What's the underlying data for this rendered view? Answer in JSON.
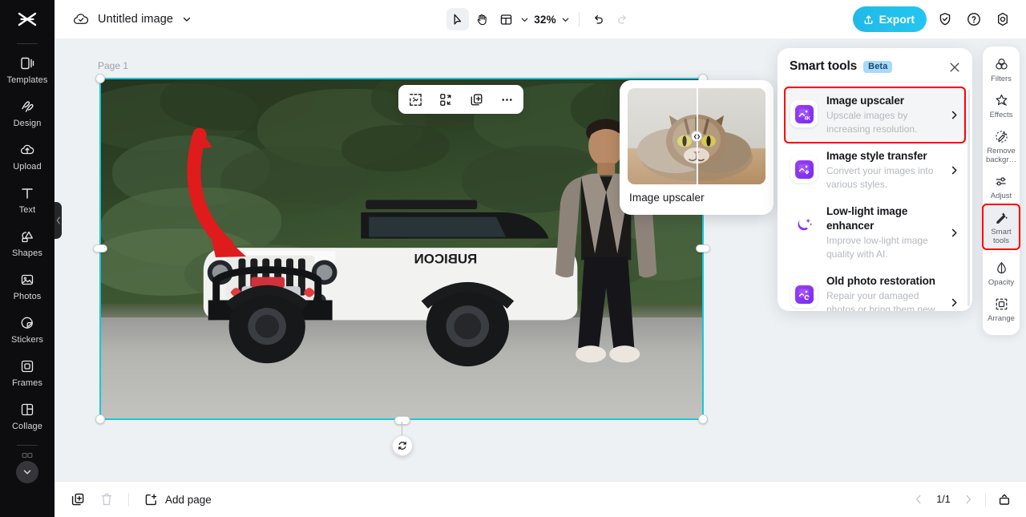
{
  "app": {
    "name": "CapCut",
    "logo_icon": "capcut-logo-icon"
  },
  "topbar": {
    "cloud_icon": "cloud-saved-icon",
    "doc_title": "Untitled image",
    "doc_title_chevron": "chevron-down-icon",
    "tools": [
      {
        "name": "select-tool",
        "icon": "cursor-arrow-icon",
        "active": true
      },
      {
        "name": "hand-tool",
        "icon": "hand-icon",
        "active": false
      },
      {
        "name": "layout-tool",
        "icon": "layout-grid-icon",
        "active": false
      }
    ],
    "layout_chevron": "chevron-down-icon",
    "zoom_level": "32%",
    "zoom_chevron": "chevron-down-icon",
    "undo_icon": "undo-arrow-icon",
    "redo_icon": "redo-arrow-icon",
    "export_label": "Export",
    "export_icon": "upload-icon",
    "export_color": "#22c0ec",
    "right_icons": [
      {
        "name": "shield-check-icon",
        "label": "Security"
      },
      {
        "name": "help-question-icon",
        "label": "Help"
      },
      {
        "name": "settings-gear-icon",
        "label": "Settings"
      }
    ]
  },
  "sidebar": {
    "items": [
      {
        "label": "Templates",
        "icon": "templates-icon"
      },
      {
        "label": "Design",
        "icon": "design-icon"
      },
      {
        "label": "Upload",
        "icon": "upload-cloud-icon"
      },
      {
        "label": "Text",
        "icon": "text-t-icon"
      },
      {
        "label": "Shapes",
        "icon": "shapes-icon"
      },
      {
        "label": "Photos",
        "icon": "photos-image-icon"
      },
      {
        "label": "Stickers",
        "icon": "stickers-icon"
      },
      {
        "label": "Frames",
        "icon": "frames-icon"
      },
      {
        "label": "Collage",
        "icon": "collage-icon"
      }
    ],
    "expand_icon": "chevron-down-circle-icon",
    "collapse_handle_icon": "chevron-left-icon"
  },
  "canvas": {
    "page_label": "Page 1",
    "selection_color": "#19c7de",
    "floating_tools": [
      {
        "name": "crop-tool",
        "icon": "crop-dashed-icon"
      },
      {
        "name": "flip-tool",
        "icon": "flip-swap-icon"
      },
      {
        "name": "duplicate-tool",
        "icon": "duplicate-plus-icon"
      },
      {
        "name": "more-tool",
        "icon": "more-dots-icon"
      }
    ],
    "corner_tools": [
      {
        "name": "replace-image",
        "icon": "image-stack-icon"
      },
      {
        "name": "more-options",
        "icon": "more-dots-icon"
      }
    ],
    "rotate_icon": "rotate-refresh-icon",
    "artwork_alt": "White Jeep Wrangler Rubicon on a forest gravel road with a man in a grey blazer standing beside it, red arrow annotation pointing at the Jeep front grille"
  },
  "preview_card": {
    "label": "Image upscaler",
    "image_alt": "Tabby cat before/after upscaling comparison",
    "split_handle_icon": "split-compare-icon"
  },
  "smart_tools_panel": {
    "title": "Smart tools",
    "badge": "Beta",
    "badge_color": "#aad9fb",
    "close_icon": "close-x-icon",
    "highlight_color": "#ff0000",
    "items": [
      {
        "name": "Image upscaler",
        "description": "Upscale images by increasing resolution.",
        "icon": "image-upscaler-4k-icon",
        "chevron": "chevron-right-icon",
        "selected": true,
        "highlighted": true
      },
      {
        "name": "Image style transfer",
        "description": "Convert your images into various styles.",
        "icon": "image-style-transfer-icon",
        "chevron": "chevron-right-icon",
        "selected": false,
        "highlighted": false
      },
      {
        "name": "Low-light image enhancer",
        "description": "Improve low-light image quality with AI.",
        "icon": "moon-sparkle-icon",
        "chevron": "chevron-right-icon",
        "selected": false,
        "highlighted": false
      },
      {
        "name": "Old photo restoration",
        "description": "Repair your damaged photos or bring them new life with…",
        "icon": "old-photo-restoration-icon",
        "chevron": "chevron-right-icon",
        "selected": false,
        "highlighted": false
      }
    ]
  },
  "right_toolbar": {
    "items": [
      {
        "label": "Filters",
        "icon": "filters-circles-icon",
        "selected": false,
        "highlighted": false
      },
      {
        "label": "Effects",
        "icon": "effects-star-icon",
        "selected": false,
        "highlighted": false
      },
      {
        "label": "Remove backgr…",
        "icon": "remove-background-icon",
        "selected": false,
        "highlighted": false
      },
      {
        "label": "Adjust",
        "icon": "adjust-sliders-icon",
        "selected": false,
        "highlighted": false
      },
      {
        "label": "Smart tools",
        "icon": "smart-tools-wand-icon",
        "selected": true,
        "highlighted": true
      },
      {
        "label": "Opacity",
        "icon": "opacity-drop-icon",
        "selected": false,
        "highlighted": false
      },
      {
        "label": "Arrange",
        "icon": "arrange-dashed-icon",
        "selected": false,
        "highlighted": false
      }
    ]
  },
  "bottombar": {
    "duplicate_page_icon": "duplicate-page-icon",
    "delete_page_icon": "trash-icon",
    "add_page_label": "Add page",
    "add_page_icon": "add-page-plus-icon",
    "prev_icon": "chevron-left-icon",
    "page_indicator": "1/1",
    "next_icon": "chevron-right-icon",
    "timeline_icon": "timeline-panel-icon"
  }
}
